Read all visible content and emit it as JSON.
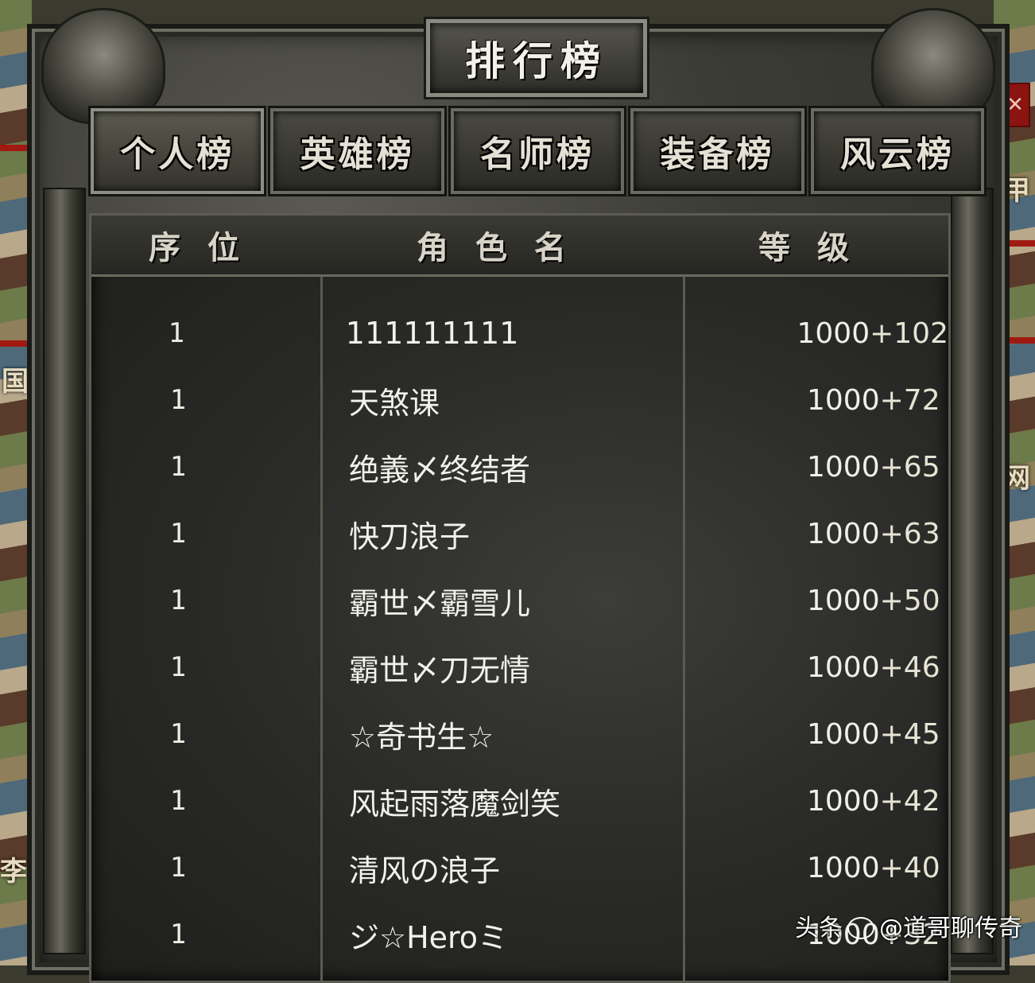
{
  "window": {
    "title": "排行榜"
  },
  "tabs": [
    {
      "label": "个人榜",
      "active": true
    },
    {
      "label": "英雄榜",
      "active": false
    },
    {
      "label": "名师榜",
      "active": false
    },
    {
      "label": "装备榜",
      "active": false
    },
    {
      "label": "风云榜",
      "active": false
    }
  ],
  "table": {
    "headers": {
      "rank": "序位",
      "name": "角色名",
      "level": "等级"
    },
    "rows": [
      {
        "rank": "1",
        "name": "111111111",
        "level_base": "1000",
        "level_bonus": "+102"
      },
      {
        "rank": "1",
        "name": "天煞课",
        "level_base": "1000",
        "level_bonus": "+72"
      },
      {
        "rank": "1",
        "name": "绝義〆终结者",
        "level_base": "1000",
        "level_bonus": "+65"
      },
      {
        "rank": "1",
        "name": "快刀浪子",
        "level_base": "1000",
        "level_bonus": "+63"
      },
      {
        "rank": "1",
        "name": "霸世〆霸雪儿",
        "level_base": "1000",
        "level_bonus": "+50"
      },
      {
        "rank": "1",
        "name": "霸世〆刀无情",
        "level_base": "1000",
        "level_bonus": "+46"
      },
      {
        "rank": "1",
        "name": "☆奇书生☆",
        "level_base": "1000",
        "level_bonus": "+45"
      },
      {
        "rank": "1",
        "name": "风起雨落魔剑笑",
        "level_base": "1000",
        "level_bonus": "+42"
      },
      {
        "rank": "1",
        "name": "清风の浪子",
        "level_base": "1000",
        "level_bonus": "+40"
      },
      {
        "rank": "1",
        "name": "ジ☆Heroミ",
        "level_base": "1000",
        "level_bonus": "+32"
      }
    ]
  },
  "side_labels": {
    "right_top": "甲",
    "left_mid": "国",
    "right_mid": "网",
    "left_bottom": "李"
  },
  "close_button": {
    "label": "✕"
  },
  "watermark": {
    "source": "头条",
    "handle": "@道哥聊传奇"
  }
}
